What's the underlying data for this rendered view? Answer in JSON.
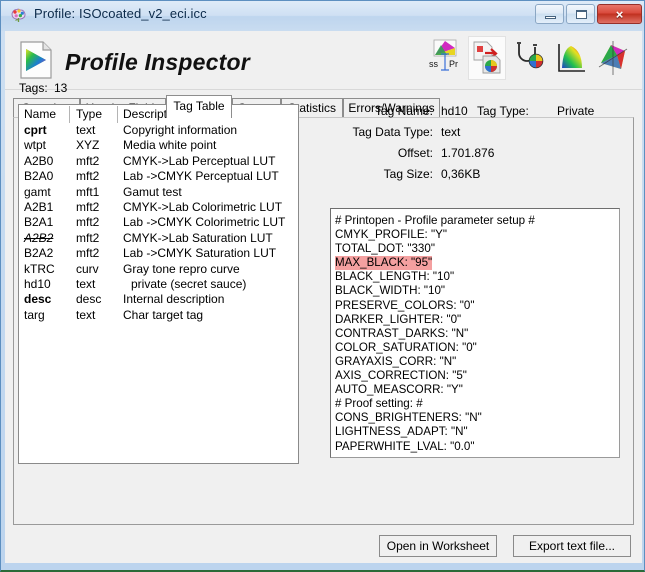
{
  "window": {
    "title": "Profile: ISOcoated_v2_eci.icc",
    "icon": "color-brain-icon",
    "controls": {
      "minimize": "minimize-icon",
      "maximize": "maximize-icon",
      "close": "×"
    }
  },
  "header": {
    "app_title": "Profile Inspector",
    "logo": "profile-document-icon",
    "tools": [
      {
        "name": "gamut-text-tool-icon",
        "active": false
      },
      {
        "name": "profile-convert-tool-icon",
        "active": true
      },
      {
        "name": "stethoscope-inspect-tool-icon",
        "active": false
      },
      {
        "name": "chromaticity-diagram-tool-icon",
        "active": false
      },
      {
        "name": "3d-gamut-tool-icon",
        "active": false
      }
    ]
  },
  "tabs": [
    {
      "label": "Overview",
      "selected": false
    },
    {
      "label": "Header Fields",
      "selected": false
    },
    {
      "label": "Tag Table",
      "selected": true
    },
    {
      "label": "Curves",
      "selected": false
    },
    {
      "label": "Statistics",
      "selected": false
    },
    {
      "label": "Errors/Warnings",
      "selected": false
    }
  ],
  "tag_table": {
    "count_label": "Tags:",
    "count_value": "13",
    "columns": [
      "Name",
      "Type",
      "Description"
    ],
    "rows": [
      {
        "name": "cprt",
        "type": "text",
        "description": "Copyright information",
        "style": "bold"
      },
      {
        "name": "wtpt",
        "type": "XYZ",
        "description": "Media white point",
        "style": "normal"
      },
      {
        "name": "A2B0",
        "type": "mft2",
        "description": "CMYK->Lab  Perceptual LUT",
        "style": "normal"
      },
      {
        "name": "B2A0",
        "type": "mft2",
        "description": "Lab ->CMYK Perceptual LUT",
        "style": "normal"
      },
      {
        "name": "gamt",
        "type": "mft1",
        "description": "Gamut test",
        "style": "normal"
      },
      {
        "name": "A2B1",
        "type": "mft2",
        "description": "CMYK->Lab  Colorimetric LUT",
        "style": "normal"
      },
      {
        "name": "B2A1",
        "type": "mft2",
        "description": "Lab ->CMYK Colorimetric LUT",
        "style": "normal"
      },
      {
        "name": "A2B2",
        "type": "mft2",
        "description": "CMYK->Lab  Saturation LUT",
        "style": "italic"
      },
      {
        "name": "B2A2",
        "type": "mft2",
        "description": "Lab ->CMYK Saturation LUT",
        "style": "normal"
      },
      {
        "name": "kTRC",
        "type": "curv",
        "description": "Gray tone repro curve",
        "style": "normal"
      },
      {
        "name": "hd10",
        "type": "text",
        "description": "private (secret sauce)",
        "style": "indent"
      },
      {
        "name": "desc",
        "type": "desc",
        "description": "Internal description",
        "style": "bold"
      },
      {
        "name": "targ",
        "type": "text",
        "description": "Char target tag",
        "style": "normal"
      }
    ]
  },
  "details": {
    "tag_name_label": "Tag Name:",
    "tag_name_value": "hd10",
    "tag_type_label": "Tag Type:",
    "tag_type_value": "Private",
    "tag_data_type_label": "Tag Data Type:",
    "tag_data_type_value": "text",
    "offset_label": "Offset:",
    "offset_value": "1.701.876",
    "tag_size_label": "Tag Size:",
    "tag_size_value": "0,36KB"
  },
  "text_view": {
    "highlight_color": "#f4a0a0",
    "highlighted_line_index": 3,
    "lines": [
      "# Printopen - Profile parameter setup #",
      "CMYK_PROFILE: \"Y\"",
      "TOTAL_DOT: \"330\"",
      "MAX_BLACK: \"95\"",
      "BLACK_LENGTH: \"10\"",
      "BLACK_WIDTH: \"10\"",
      "PRESERVE_COLORS: \"0\"",
      "DARKER_LIGHTER: \"0\"",
      "CONTRAST_DARKS: \"N\"",
      "COLOR_SATURATION: \"0\"",
      "GRAYAXIS_CORR: \"N\"",
      "AXIS_CORRECTION: \"5\"",
      "AUTO_MEASCORR: \"Y\"",
      "# Proof setting: #",
      "CONS_BRIGHTENERS: \"N\"",
      "LIGHTNESS_ADAPT: \"N\"",
      "PAPERWHITE_LVAL: \"0.0\""
    ]
  },
  "buttons": {
    "open_worksheet": "Open in Worksheet",
    "export_text": "Export text file..."
  }
}
